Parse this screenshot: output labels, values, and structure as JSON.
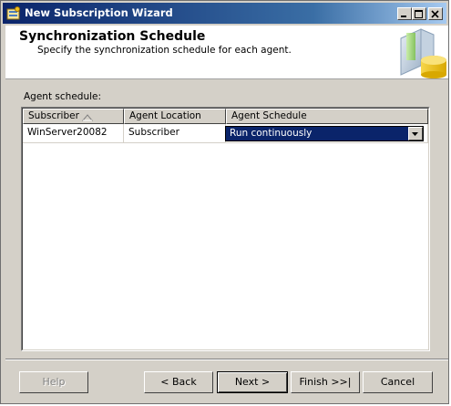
{
  "window": {
    "title": "New Subscription Wizard",
    "controls": [
      "minimize-icon",
      "maximize-icon",
      "close-icon"
    ]
  },
  "header": {
    "title": "Synchronization Schedule",
    "subtitle": "Specify the synchronization schedule for each agent."
  },
  "agent_schedule": {
    "label": "Agent schedule:",
    "columns": [
      "Subscriber",
      "Agent Location",
      "Agent Schedule"
    ],
    "sorted_column": "Subscriber",
    "rows": [
      {
        "subscriber": "WinServer20082",
        "location": "Subscriber",
        "schedule": "Run continuously"
      }
    ]
  },
  "buttons": {
    "help": "Help",
    "back": "< Back",
    "next": "Next >",
    "finish": "Finish >>|",
    "cancel": "Cancel"
  },
  "colors": {
    "title_bar_start": "#0a246a",
    "title_bar_end": "#a6caf0",
    "selection": "#0a246a",
    "face": "#d4d0c8"
  }
}
